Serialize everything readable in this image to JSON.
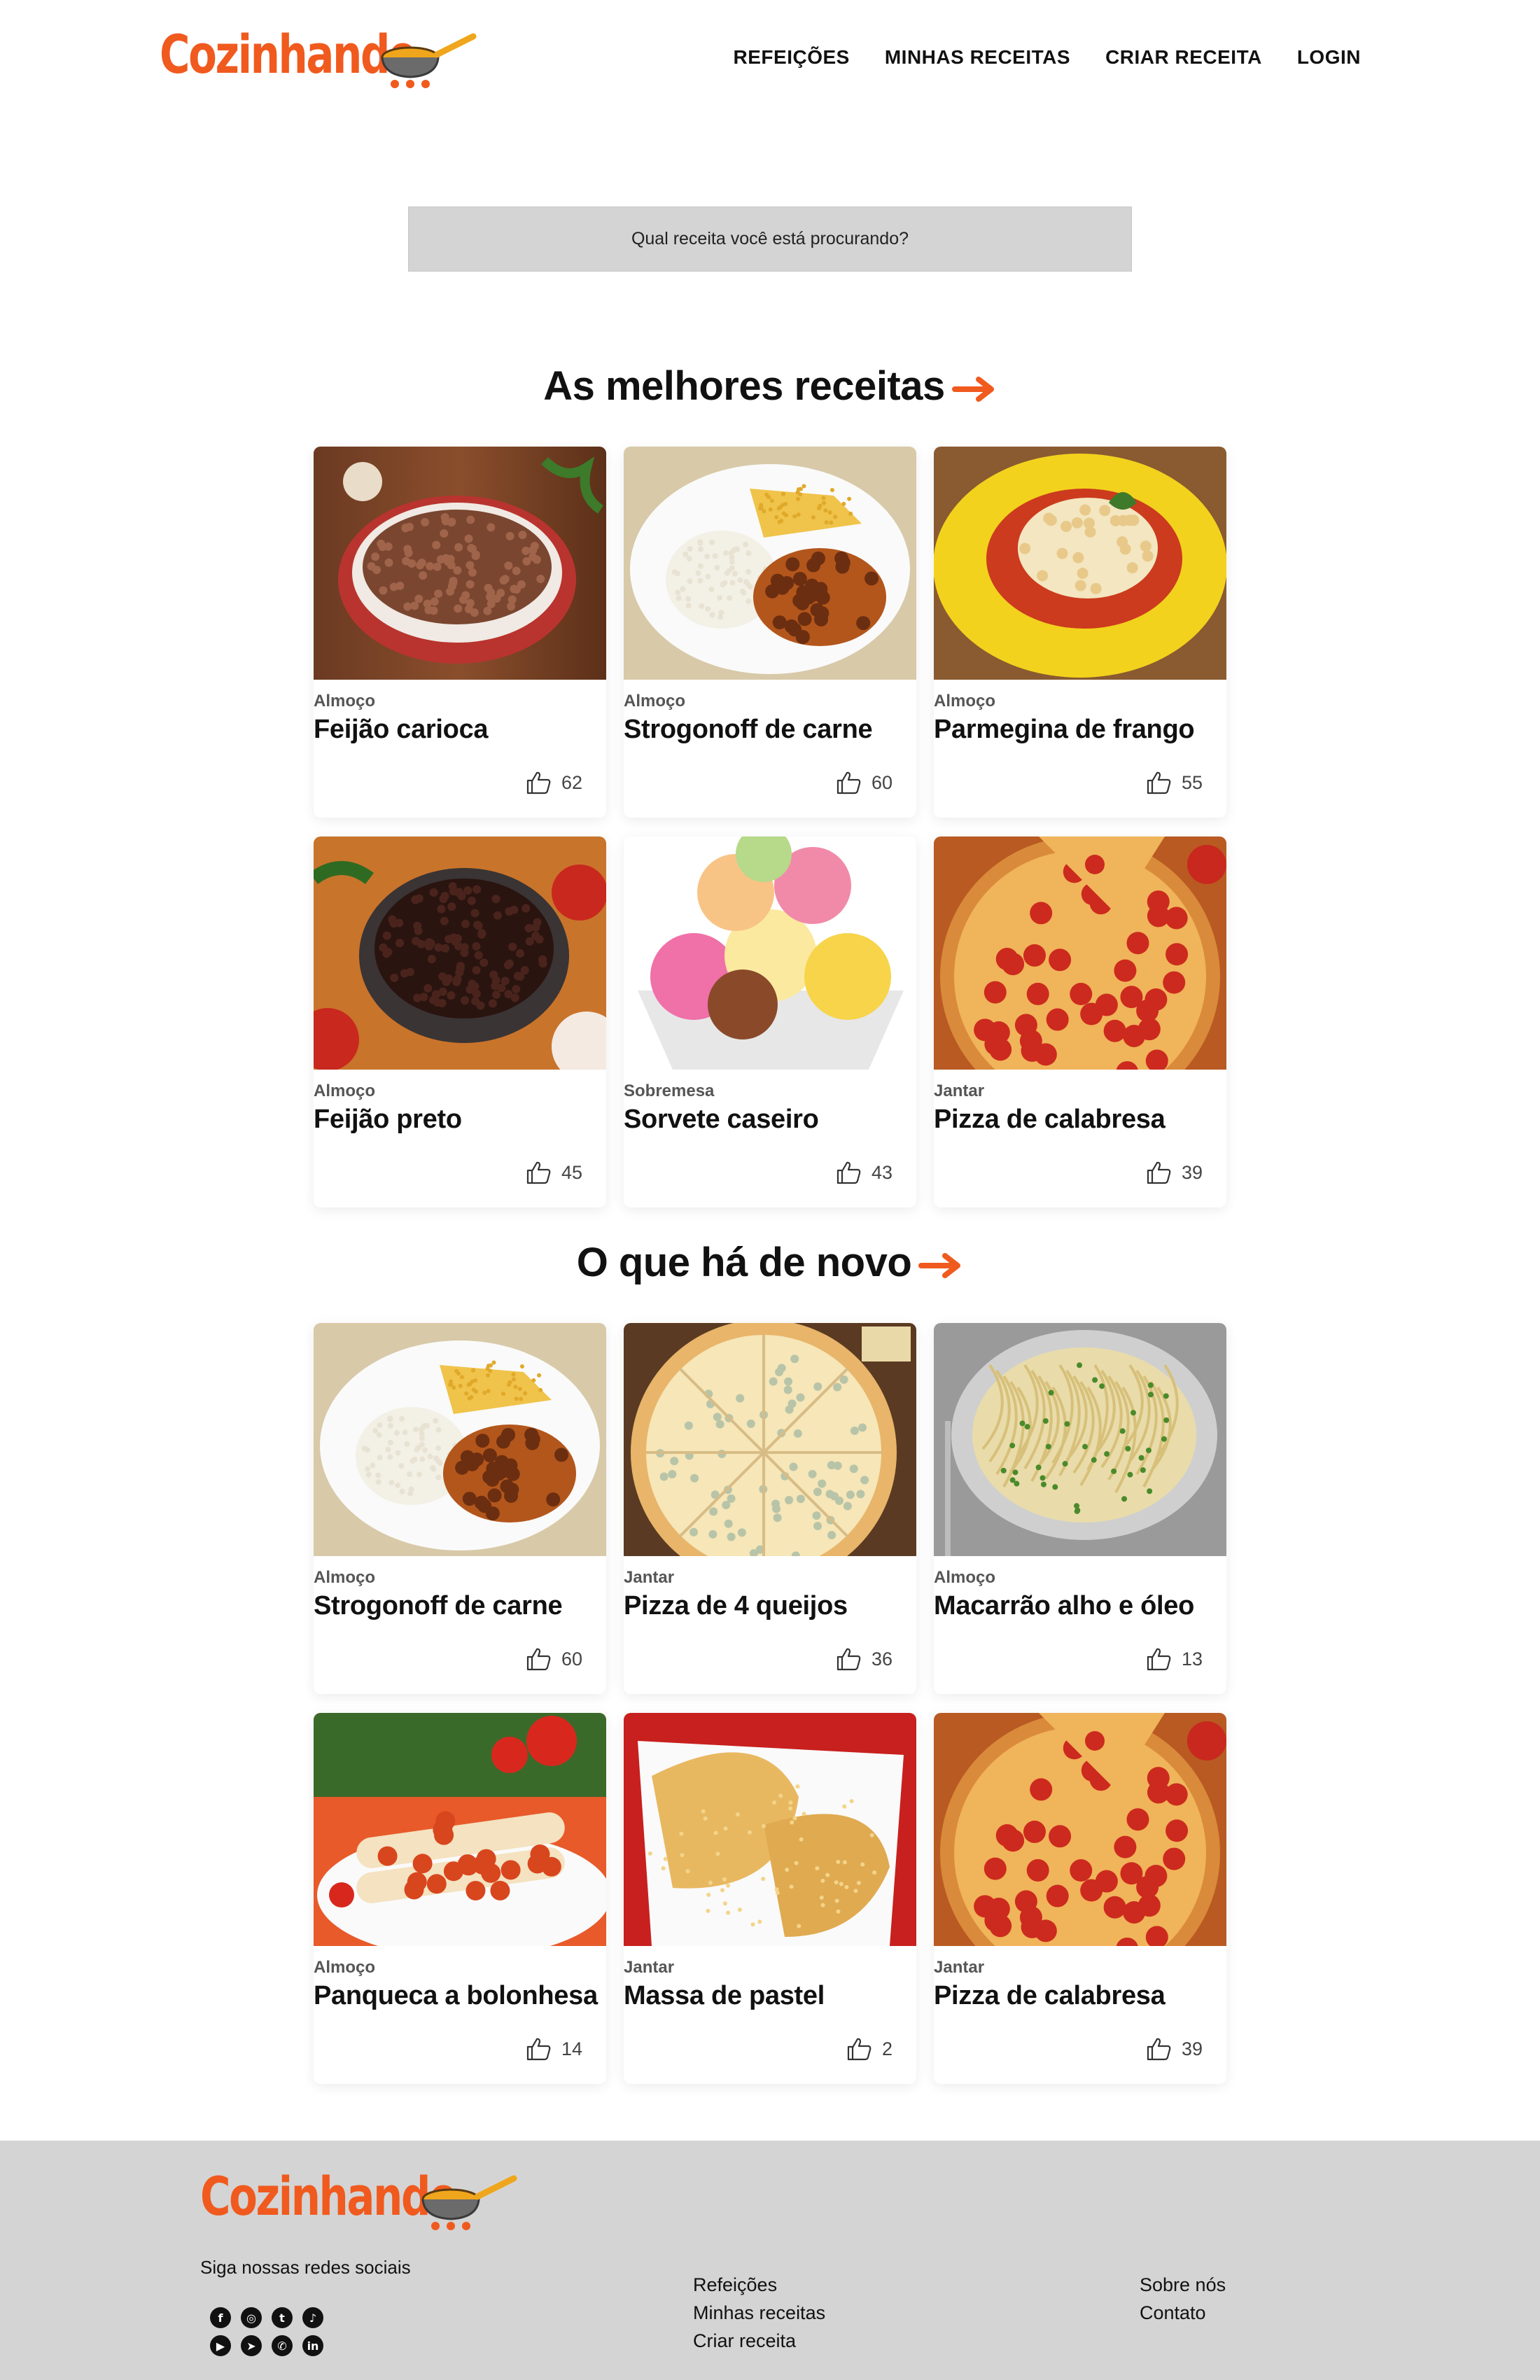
{
  "brand": {
    "name": "Cozinhando",
    "dots": "...",
    "accent": "#f05a1e",
    "pan_color": "#f0a61c"
  },
  "nav": [
    "REFEIÇÕES",
    "MINHAS RECEITAS",
    "CRIAR RECEITA",
    "LOGIN"
  ],
  "search": {
    "placeholder": "Qual receita você está procurando?"
  },
  "sections": [
    {
      "title": "As melhores receitas",
      "cards": [
        {
          "category": "Almoço",
          "title": "Feijão carioca",
          "likes": "62",
          "image": "bean-stew-bowl"
        },
        {
          "category": "Almoço",
          "title": "Strogonoff de carne",
          "likes": "60",
          "image": "stroganoff-plate"
        },
        {
          "category": "Almoço",
          "title": "Parmegina de frango",
          "likes": "55",
          "image": "chicken-parmigiana"
        },
        {
          "category": "Almoço",
          "title": "Feijão preto",
          "likes": "45",
          "image": "black-bean-pot"
        },
        {
          "category": "Sobremesa",
          "title": "Sorvete caseiro",
          "likes": "43",
          "image": "ice-cream-bowl"
        },
        {
          "category": "Jantar",
          "title": "Pizza de calabresa",
          "likes": "39",
          "image": "pepperoni-pizza"
        }
      ]
    },
    {
      "title": "O que há de novo",
      "cards": [
        {
          "category": "Almoço",
          "title": "Strogonoff de carne",
          "likes": "60",
          "image": "stroganoff-plate"
        },
        {
          "category": "Jantar",
          "title": "Pizza de 4 queijos",
          "likes": "36",
          "image": "cheese-pizza"
        },
        {
          "category": "Almoço",
          "title": "Macarrão alho e óleo",
          "likes": "13",
          "image": "spaghetti-plate"
        },
        {
          "category": "Almoço",
          "title": "Panqueca a bolonhesa",
          "likes": "14",
          "image": "pancake-rolls"
        },
        {
          "category": "Jantar",
          "title": "Massa de pastel",
          "likes": "2",
          "image": "fried-pastel"
        },
        {
          "category": "Jantar",
          "title": "Pizza de calabresa",
          "likes": "39",
          "image": "pepperoni-pizza"
        }
      ]
    }
  ],
  "footer": {
    "follow": "Siga nossas redes sociais",
    "social": [
      "facebook-icon",
      "instagram-icon",
      "twitter-icon",
      "tiktok-icon",
      "youtube-icon",
      "telegram-icon",
      "whatsapp-icon",
      "linkedin-icon"
    ],
    "links_col1": [
      "Refeições",
      "Minhas receitas",
      "Criar receita"
    ],
    "links_col2": [
      "Sobre nós",
      "Contato"
    ]
  }
}
